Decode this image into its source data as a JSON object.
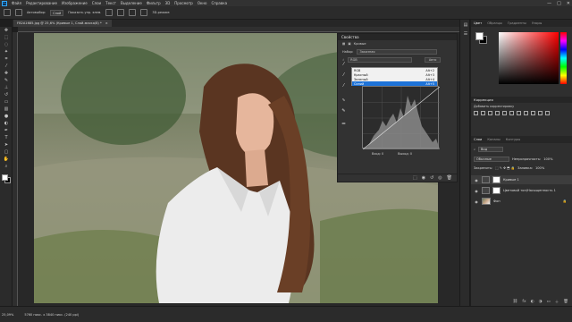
{
  "menubar": {
    "items": [
      "Файл",
      "Редактирование",
      "Изображение",
      "Слои",
      "Текст",
      "Выделение",
      "Фильтр",
      "3D",
      "Просмотр",
      "Окно",
      "Справка"
    ]
  },
  "options": {
    "autoselect": "Автовыбор:",
    "group": "Слой",
    "show_controls": "Показать упр. элем.",
    "mode3d": "3D-режим:"
  },
  "document": {
    "tab": "FB2A1685.jpg @ 25,6% (Кривые 1, Слой-маска/8) *"
  },
  "status": {
    "zoom": "25,09%",
    "info": "5760 пикс. x 3840 пикс. (240 ppi)"
  },
  "properties": {
    "title": "Свойства",
    "subtitle": "Кривые",
    "preset_label": "Набор:",
    "preset_value": "Заказная",
    "channel_value": "RGB",
    "auto_label": "Авто",
    "channels": [
      {
        "name": "RGB",
        "key": "Alt+2"
      },
      {
        "name": "Красный",
        "key": "Alt+3"
      },
      {
        "name": "Зеленый",
        "key": "Alt+4"
      },
      {
        "name": "Синий",
        "key": "Alt+5"
      }
    ],
    "input_label": "Вход:",
    "input_value": "0",
    "output_label": "Выход:",
    "output_value": "0"
  },
  "panels": {
    "color_tabs": [
      "Цвет",
      "Образцы",
      "Градиенты",
      "Узоры"
    ],
    "adjust_title": "Коррекция",
    "adjust_label": "Добавить корректировку",
    "layer_tabs": [
      "Слои",
      "Каналы",
      "Контуры"
    ],
    "kind": "Вид",
    "blend": "Обычные",
    "opacity_label": "Непрозрачность:",
    "opacity": "100%",
    "lock_label": "Закрепить:",
    "fill_label": "Заливка:",
    "fill": "100%"
  },
  "layers": [
    {
      "name": "Кривые 1"
    },
    {
      "name": "Цветовой тон/Насыщенность 1"
    },
    {
      "name": "Фон"
    }
  ],
  "window": {
    "minimize": "—",
    "maximize": "□",
    "close": "✕"
  },
  "icons": [
    "move-icon",
    "marquee-icon",
    "lasso-icon",
    "magic-wand-icon",
    "crop-icon",
    "eyedropper-icon",
    "healing-icon",
    "brush-icon",
    "stamp-icon",
    "history-brush-icon",
    "eraser-icon",
    "gradient-icon",
    "blur-icon",
    "dodge-icon",
    "pen-icon",
    "type-icon",
    "path-select-icon",
    "shape-icon",
    "hand-icon",
    "zoom-icon"
  ]
}
